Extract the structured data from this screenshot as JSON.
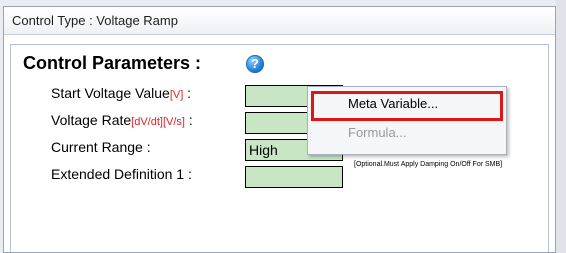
{
  "window": {
    "title": "Control Type : Voltage Ramp"
  },
  "panel": {
    "heading": "Control Parameters :",
    "help_icon": "help-icon",
    "help_glyph": "?"
  },
  "fields": {
    "start_voltage": {
      "label": "Start Voltage Value",
      "unit": "[V]",
      "suffix": " :",
      "value": ""
    },
    "voltage_rate": {
      "label": "Voltage Rate",
      "unit": "[dV/dt][V/s]",
      "suffix": " :",
      "value": ""
    },
    "current_range": {
      "label": "Current Range :",
      "value": "High"
    },
    "extended_definition": {
      "label": "Extended Definition 1 :",
      "value": ""
    }
  },
  "note": "[Optional.Must Apply Damping On/Off For SMB]",
  "context_menu": {
    "items": [
      {
        "label": "Meta Variable...",
        "enabled": true
      },
      {
        "label": "Formula...",
        "enabled": false
      }
    ]
  },
  "colors": {
    "field_bg": "#c8e6c4",
    "unit_text": "#e02020",
    "highlight": "#e01515"
  }
}
